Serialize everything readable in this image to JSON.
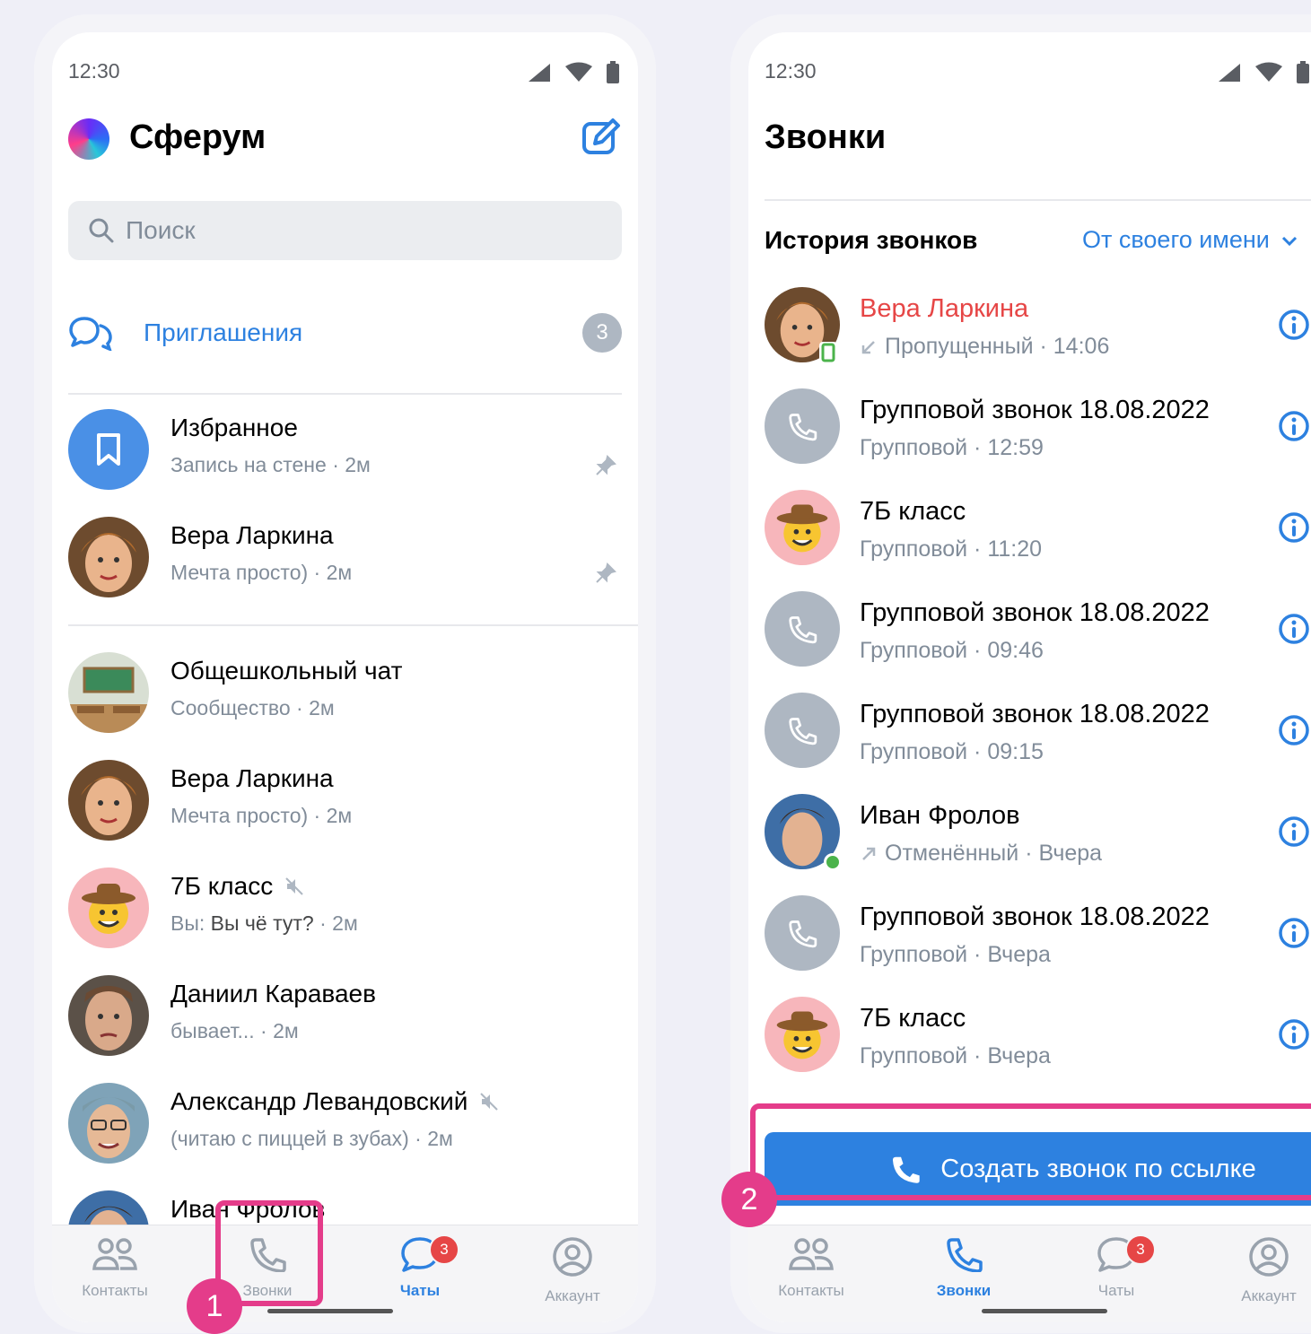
{
  "left": {
    "status_time": "12:30",
    "app_title": "Сферум",
    "search_placeholder": "Поиск",
    "invitations_label": "Приглашения",
    "invitations_count": "3",
    "pinned": [
      {
        "name": "Избранное",
        "sub": "Запись на стене",
        "time": "2м"
      },
      {
        "name": "Вера Ларкина",
        "sub": "Мечта просто)",
        "time": "2м"
      }
    ],
    "chats": [
      {
        "name": "Общешкольный чат",
        "sub": "Сообщество",
        "time": "2м"
      },
      {
        "name": "Вера Ларкина",
        "sub": "Мечта просто)",
        "time": "2м"
      },
      {
        "name": "7Б класс",
        "sub_prefix": "Вы:",
        "sub": "Вы чё тут?",
        "time": "2м",
        "muted": true
      },
      {
        "name": "Даниил Караваев",
        "sub": "бывает...",
        "time": "2м"
      },
      {
        "name": "Александр Левандовский",
        "sub": "(читаю с пиццей в зубах)",
        "time": "2м",
        "muted": true
      },
      {
        "name": "Иван Фролов"
      }
    ],
    "tabs": [
      {
        "label": "Контакты"
      },
      {
        "label": "Звонки"
      },
      {
        "label": "Чаты",
        "badge": "3"
      },
      {
        "label": "Аккаунт"
      }
    ],
    "step_marker": "1"
  },
  "right": {
    "status_time": "12:30",
    "page_title": "Звонки",
    "section_title": "История звонков",
    "filter_label": "От своего имени",
    "calls": [
      {
        "name": "Вера Ларкина",
        "status": "Пропущенный",
        "time": "14:06",
        "missed": true
      },
      {
        "name": "Групповой звонок 18.08.2022",
        "status": "Групповой",
        "time": "12:59"
      },
      {
        "name": "7Б класс",
        "status": "Групповой",
        "time": "11:20"
      },
      {
        "name": "Групповой звонок 18.08.2022",
        "status": "Групповой",
        "time": "09:46"
      },
      {
        "name": "Групповой звонок 18.08.2022",
        "status": "Групповой",
        "time": "09:15"
      },
      {
        "name": "Иван Фролов",
        "status": "Отменённый",
        "time": "Вчера"
      },
      {
        "name": "Групповой звонок 18.08.2022",
        "status": "Групповой",
        "time": "Вчера"
      },
      {
        "name": "7Б класс",
        "status": "Групповой",
        "time": "Вчера"
      }
    ],
    "cta_label": "Создать звонок по ссылке",
    "tabs": [
      {
        "label": "Контакты"
      },
      {
        "label": "Звонки"
      },
      {
        "label": "Чаты",
        "badge": "3"
      },
      {
        "label": "Аккаунт"
      }
    ],
    "step_marker": "2"
  },
  "colors": {
    "accent": "#2d81e0",
    "missed": "#e64646",
    "highlight": "#e43c8a"
  }
}
